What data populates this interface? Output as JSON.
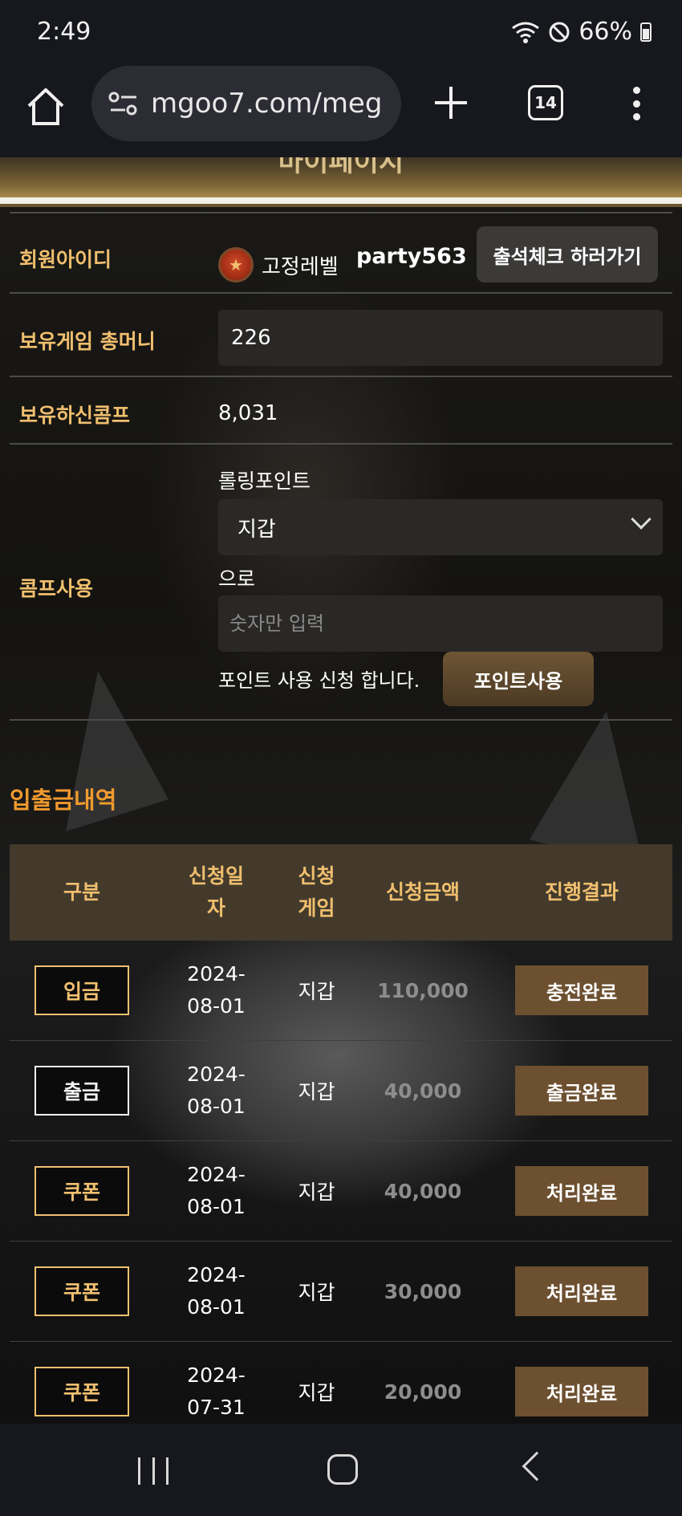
{
  "status": {
    "time": "2:49",
    "battery": "66%"
  },
  "browser": {
    "url": "mgoo7.com/meg",
    "tab_count": "14"
  },
  "banner": {
    "title": "마이페이지"
  },
  "profile": {
    "member_id_label": "회원아이디",
    "level_name": "고정레벨",
    "user_id": "party563",
    "attendance_button": "출석체크 하러가기",
    "money_label": "보유게임 총머니",
    "money_value": "226",
    "comp_label": "보유하신콤프",
    "comp_value": "8,031"
  },
  "comp_use": {
    "label": "콤프사용",
    "rolling_label": "롤링포인트",
    "selected_wallet": "지갑",
    "to_label": "으로",
    "amount_placeholder": "숫자만 입력",
    "note": "포인트 사용 신청 합니다.",
    "submit_button": "포인트사용"
  },
  "history": {
    "title": "입출금내역",
    "headers": {
      "type": "구분",
      "date_line1": "신청일",
      "date_line2": "자",
      "game_line1": "신청",
      "game_line2": "게임",
      "amount": "신청금액",
      "result": "진행결과"
    },
    "rows": [
      {
        "type": "입금",
        "date_line1": "2024-",
        "date_line2": "08-01",
        "game": "지갑",
        "amount": "110,000",
        "result": "충전완료"
      },
      {
        "type": "출금",
        "date_line1": "2024-",
        "date_line2": "08-01",
        "game": "지갑",
        "amount": "40,000",
        "result": "출금완료"
      },
      {
        "type": "쿠폰",
        "date_line1": "2024-",
        "date_line2": "08-01",
        "game": "지갑",
        "amount": "40,000",
        "result": "처리완료"
      },
      {
        "type": "쿠폰",
        "date_line1": "2024-",
        "date_line2": "08-01",
        "game": "지갑",
        "amount": "30,000",
        "result": "처리완료"
      },
      {
        "type": "쿠폰",
        "date_line1": "2024-",
        "date_line2": "07-31",
        "game": "지갑",
        "amount": "20,000",
        "result": "처리완료"
      }
    ]
  },
  "colors": {
    "accent_gold": "#f0bf6e",
    "section_orange": "#f09a2e",
    "result_brown": "#6d5030"
  },
  "icons": [
    "home-icon",
    "site-settings-icon",
    "plus-icon",
    "tabs-icon",
    "menu-icon",
    "level-medal-icon",
    "chevron-down-icon",
    "wifi-icon",
    "dnd-icon",
    "battery-icon"
  ]
}
